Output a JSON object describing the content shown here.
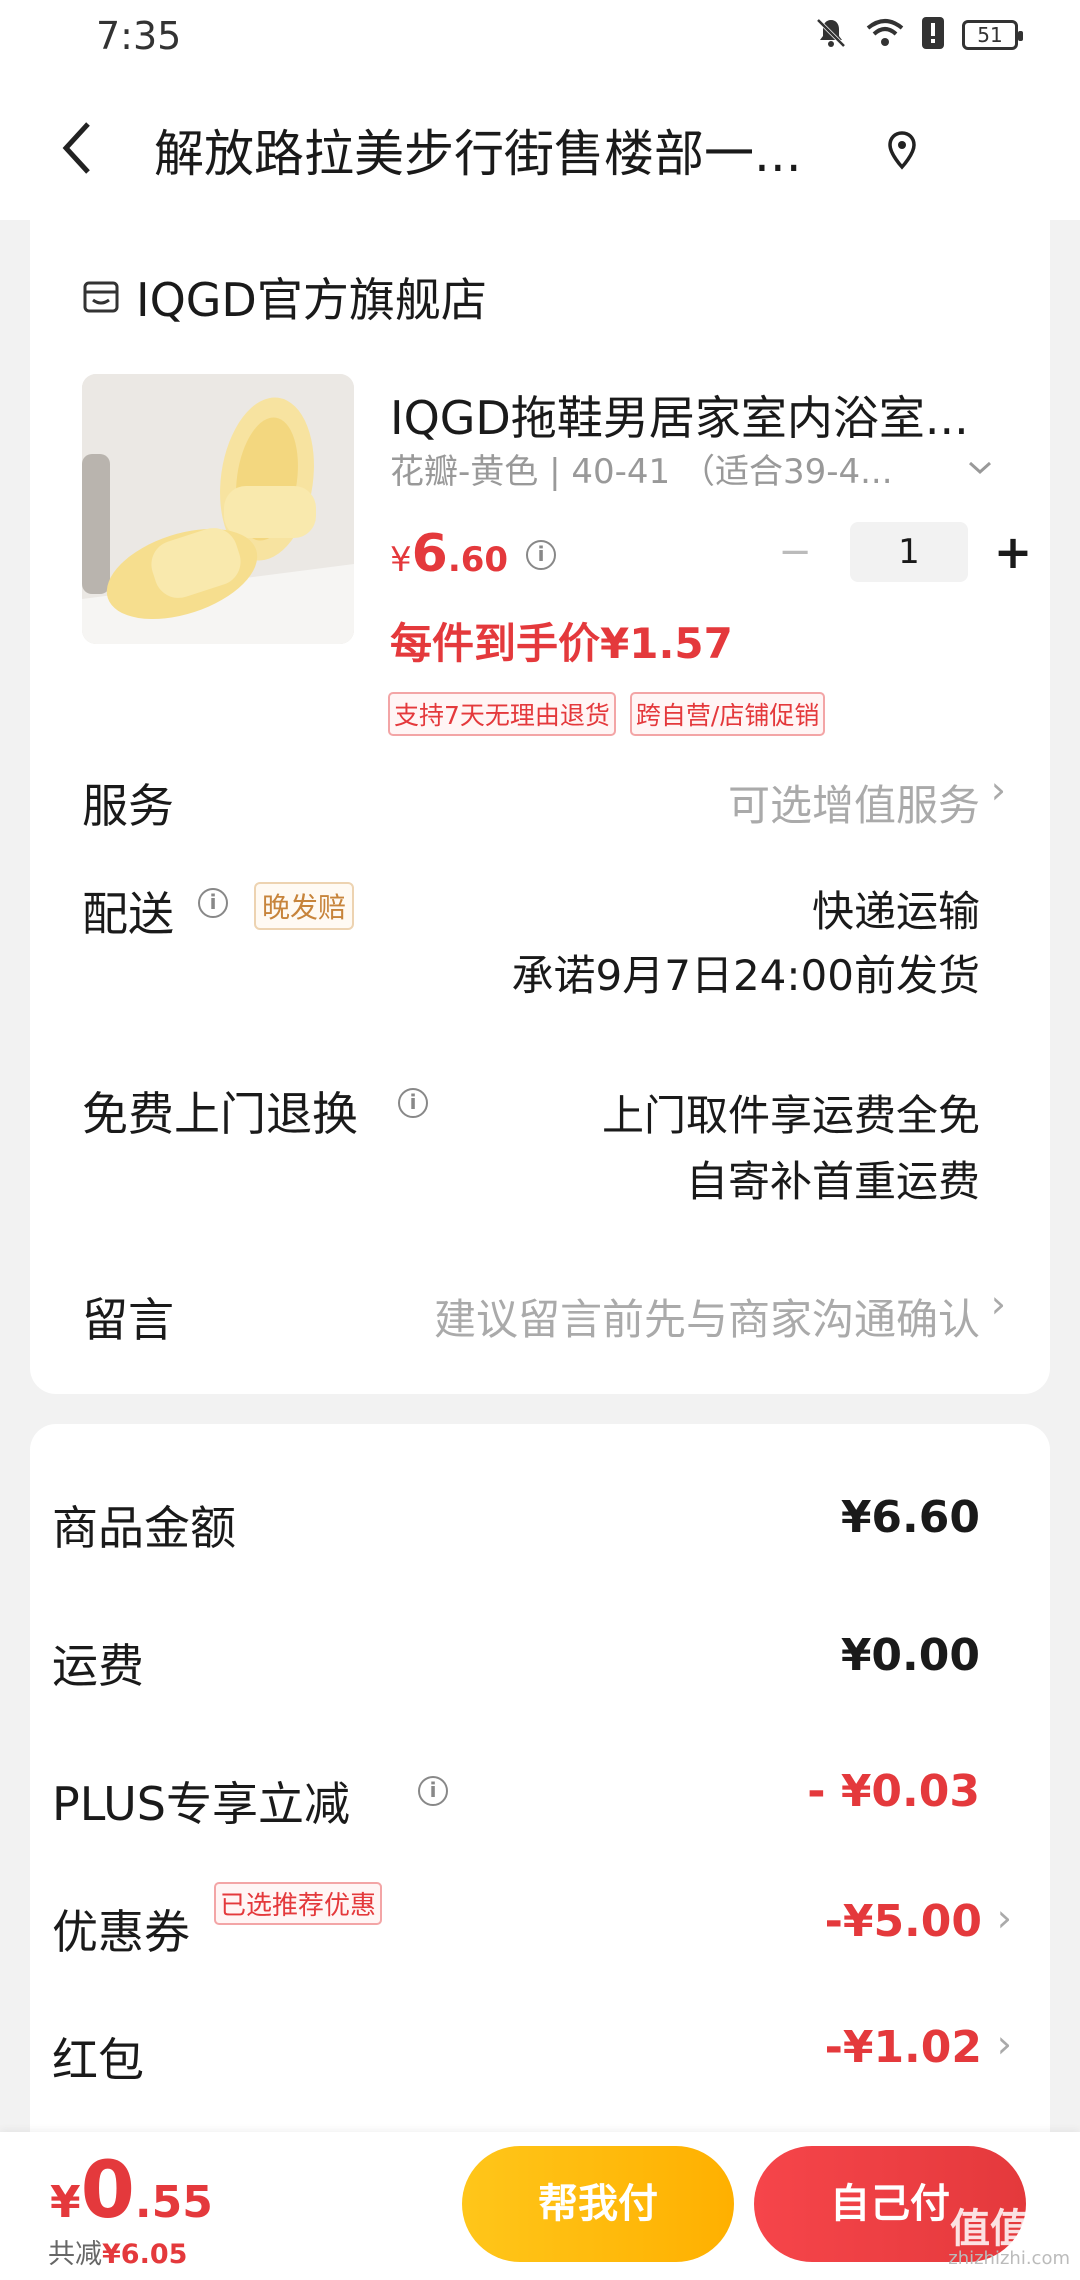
{
  "status": {
    "time": "7:35",
    "battery": "51"
  },
  "nav": {
    "title": "解放路拉美步行街售楼部一..."
  },
  "store": {
    "name": "IQGD官方旗舰店"
  },
  "product": {
    "title": "IQGD拖鞋男居家室内浴室...",
    "spec": "花瓣-黄色 | 40-41 （适合39-4...",
    "price_yen": "¥",
    "price_int": "6",
    "price_dec": ".60",
    "quantity": "1",
    "qty_minus": "−",
    "qty_plus": "+",
    "unit_price": "每件到手价¥1.57",
    "tags": [
      "支持7天无理由退货",
      "跨自营/店铺促销"
    ]
  },
  "rows": {
    "service_label": "服务",
    "service_value": "可选增值服务",
    "delivery_label": "配送",
    "delivery_badge": "晚发赔",
    "delivery_method": "快递运输",
    "delivery_promise": "承诺9月7日24:00前发货",
    "return_label": "免费上门退换",
    "return_line1": "上门取件享运费全免",
    "return_line2": "自寄补首重运费",
    "note_label": "留言",
    "note_placeholder": "建议留言前先与商家沟通确认"
  },
  "summary": {
    "goods_label": "商品金额",
    "goods_value": "¥6.60",
    "shipping_label": "运费",
    "shipping_value": "¥0.00",
    "plus_label": "PLUS专享立减",
    "plus_value": "- ¥0.03",
    "coupon_label": "优惠券",
    "coupon_badge": "已选推荐优惠",
    "coupon_value": "-¥5.00",
    "redpacket_label": "红包",
    "redpacket_value": "-¥1.02"
  },
  "bottom": {
    "total_yen": "¥",
    "total_int": "0",
    "total_dec": ".55",
    "saved_prefix": "共减",
    "saved_value": "¥6.05",
    "help_pay": "帮我付",
    "self_pay": "自己付"
  },
  "watermark": {
    "main": "值值值",
    "sub": "zhizhizhi.com"
  },
  "colors": {
    "accent_red": "#e4393c",
    "help_yellow": "#ffc61a"
  }
}
